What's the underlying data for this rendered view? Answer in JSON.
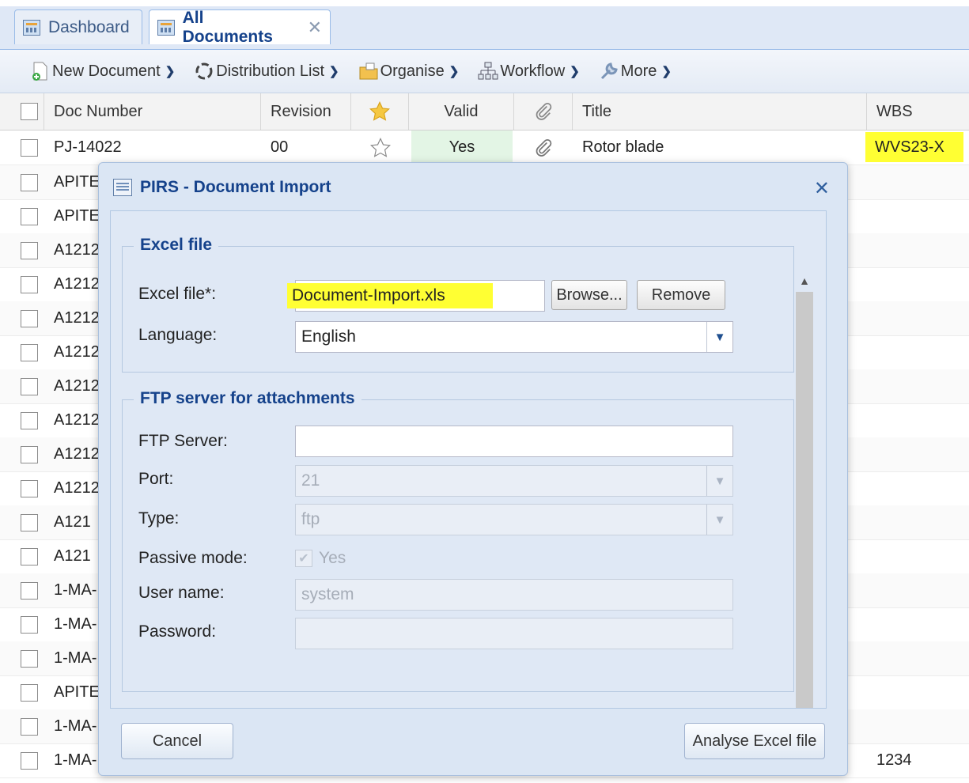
{
  "tabs": [
    {
      "label": "Dashboard"
    },
    {
      "label": "All Documents"
    }
  ],
  "toolbar": {
    "new_document": "New Document",
    "distribution_list": "Distribution List",
    "organise": "Organise",
    "workflow": "Workflow",
    "more": "More"
  },
  "grid": {
    "columns": {
      "doc_number": "Doc Number",
      "revision": "Revision",
      "valid": "Valid",
      "title": "Title",
      "wbs": "WBS"
    },
    "rows": [
      {
        "doc_number": "PJ-14022",
        "revision": "00",
        "valid": "Yes",
        "title": "Rotor blade",
        "wbs": "WVS23-X"
      },
      {
        "doc_number": "APITE"
      },
      {
        "doc_number": "APITE"
      },
      {
        "doc_number": "A1212"
      },
      {
        "doc_number": "A1212"
      },
      {
        "doc_number": "A1212"
      },
      {
        "doc_number": "A1212"
      },
      {
        "doc_number": "A1212"
      },
      {
        "doc_number": "A1212"
      },
      {
        "doc_number": "A1212"
      },
      {
        "doc_number": "A1212"
      },
      {
        "doc_number": "A121"
      },
      {
        "doc_number": "A121"
      },
      {
        "doc_number": "1-MA-"
      },
      {
        "doc_number": "1-MA-"
      },
      {
        "doc_number": "1-MA-"
      },
      {
        "doc_number": "APITE"
      },
      {
        "doc_number": "1-MA-"
      },
      {
        "doc_number": "1-MA-",
        "wbs": "1234"
      }
    ]
  },
  "dialog": {
    "title": "PIRS - Document Import",
    "excel_section": {
      "legend": "Excel file",
      "file_label": "Excel file*:",
      "file_value": "Document-Import.xls",
      "browse": "Browse...",
      "remove": "Remove",
      "language_label": "Language:",
      "language_value": "English"
    },
    "ftp_section": {
      "legend": "FTP server for attachments",
      "server_label": "FTP Server:",
      "server_value": "",
      "port_label": "Port:",
      "port_value": "21",
      "type_label": "Type:",
      "type_value": "ftp",
      "passive_label": "Passive mode:",
      "passive_value": "Yes",
      "user_label": "User name:",
      "user_value": "system",
      "password_label": "Password:",
      "password_value": ""
    },
    "cancel": "Cancel",
    "analyse": "Analyse Excel file"
  },
  "colors": {
    "highlight": "#ffff33",
    "header_blue": "#15428b",
    "valid_green": "#e3f5e5"
  }
}
